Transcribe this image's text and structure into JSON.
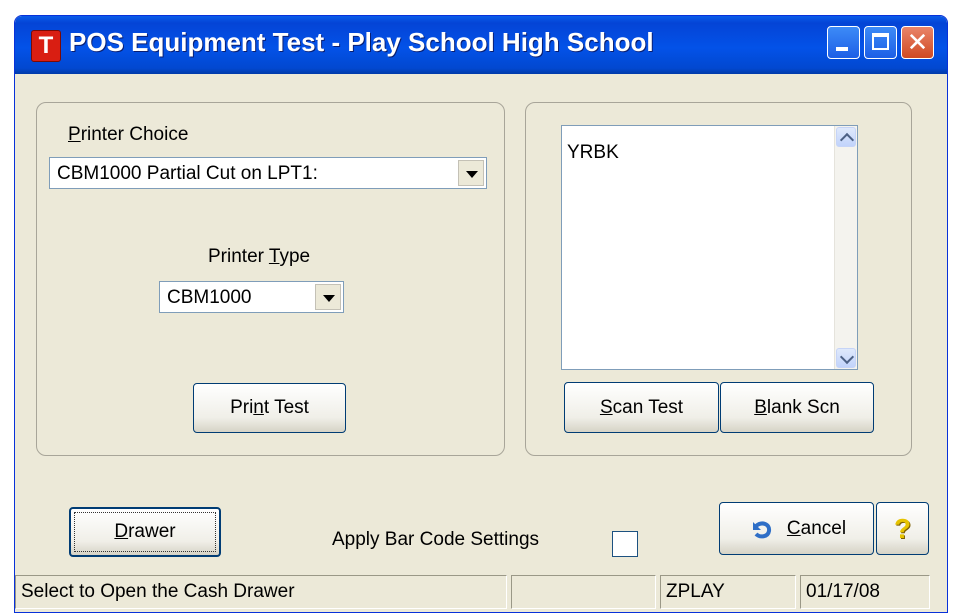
{
  "window": {
    "title": "POS Equipment Test - Play School High School",
    "app_icon_letter": "T"
  },
  "printer_panel": {
    "printer_choice_label": "Printer Choice",
    "printer_choice_value": "CBM1000 Partial Cut on LPT1:",
    "printer_type_label": "Printer Type",
    "printer_type_value": "CBM1000",
    "print_test_label": "Print Test"
  },
  "scan_panel": {
    "scan_items": [
      "YRBK"
    ],
    "scan_test_label": "Scan Test",
    "blank_scn_label": "Blank Scn"
  },
  "footer": {
    "drawer_label": "Drawer",
    "apply_barcode_label": "Apply Bar Code Settings",
    "apply_barcode_checked": false,
    "cancel_label": "Cancel",
    "help_glyph": "?"
  },
  "status_bar": {
    "message": "Select to Open the Cash Drawer",
    "blank": "",
    "user": "ZPLAY",
    "date": "01/17/08"
  },
  "colors": {
    "titlebar": "#0352e8",
    "window_bg": "#ece9d8",
    "close_button": "#d04a22",
    "app_icon": "#d91e12"
  }
}
